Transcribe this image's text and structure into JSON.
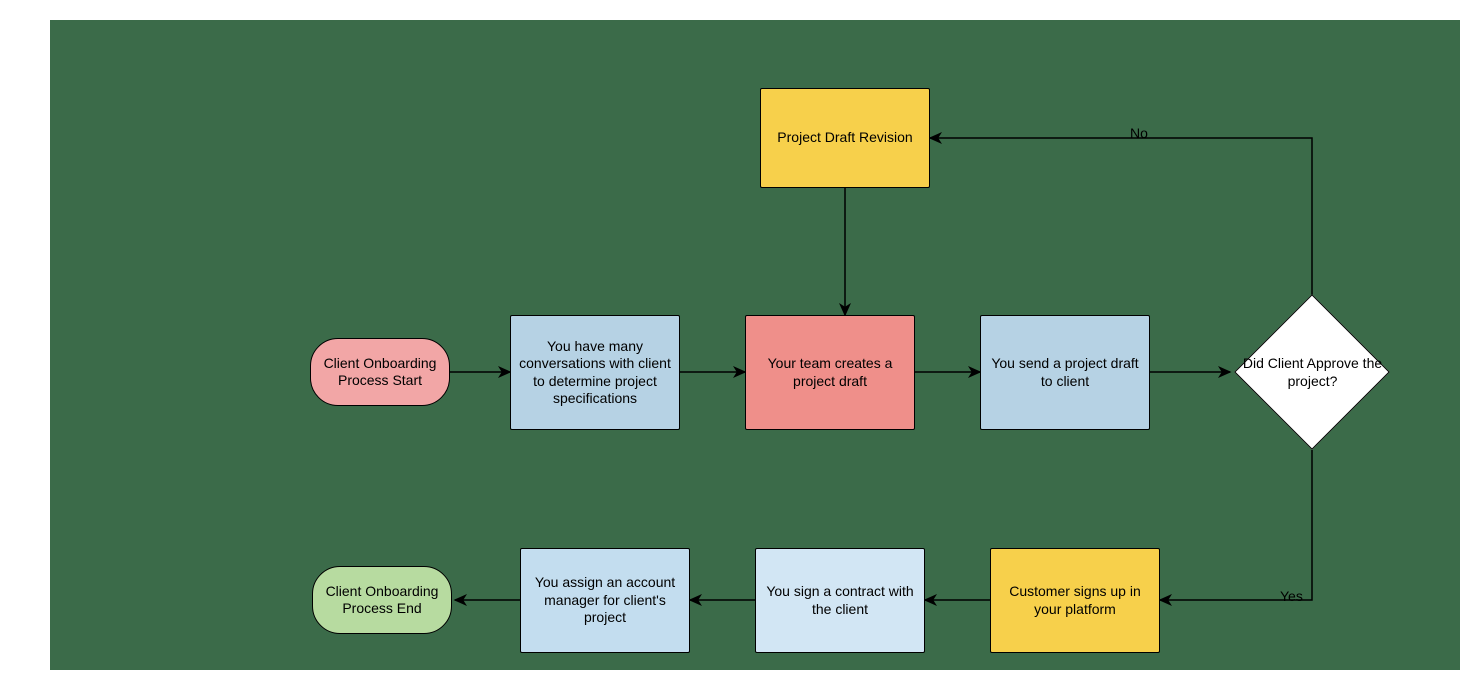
{
  "nodes": {
    "start": {
      "label": "Client Onboarding Process Start"
    },
    "conversations": {
      "label": "You have many conversations with client to determine project specifications"
    },
    "createDraft": {
      "label": "Your team creates a project draft"
    },
    "sendDraft": {
      "label": "You send a project draft to client"
    },
    "revision": {
      "label": "Project Draft Revision"
    },
    "decision": {
      "label": "Did Client Approve the project?"
    },
    "signup": {
      "label": "Customer signs up in your platform"
    },
    "contract": {
      "label": "You sign a contract with the client"
    },
    "assignMgr": {
      "label": "You assign an account manager for client's project"
    },
    "end": {
      "label": "Client Onboarding Process End"
    }
  },
  "edges": {
    "no": "No",
    "yes": "Yes"
  },
  "colors": {
    "pink": "#f2a6a6",
    "red": "#ef8f8a",
    "lightBlue": "#b6d2e4",
    "lighterBlue": "#c3ddef",
    "paleBlue": "#d2e6f4",
    "yellow": "#f7d04b",
    "green": "#b7dba0",
    "white": "#ffffff"
  }
}
